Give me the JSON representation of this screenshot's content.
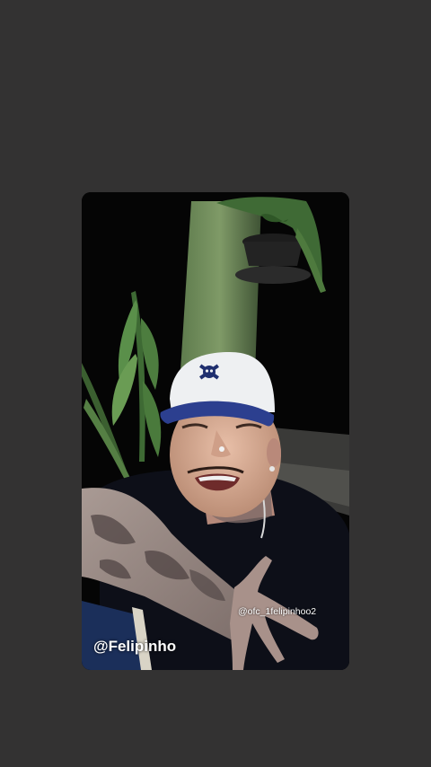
{
  "story": {
    "mention": "@ofc_1felipinhoo2",
    "username": "@Felipinho"
  },
  "media": {
    "description_icon": "video-frame"
  },
  "colors": {
    "page_background": "#333232",
    "card_background": "#060606",
    "cap_white": "#eef0f2",
    "cap_brim_blue": "#2c3f8f"
  }
}
